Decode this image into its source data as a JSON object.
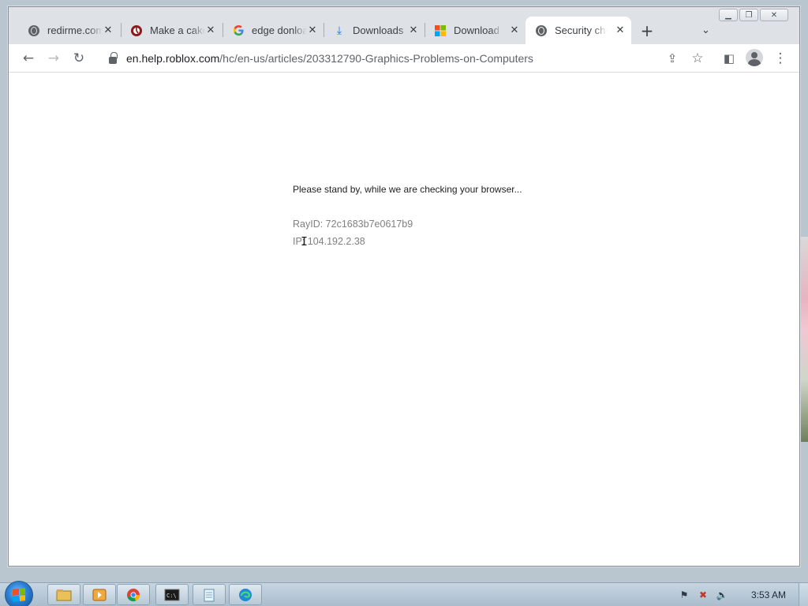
{
  "browser": {
    "tabs": [
      {
        "title": "redirme.com",
        "icon": "globe-icon"
      },
      {
        "title": "Make a cake",
        "icon": "cake-site-icon"
      },
      {
        "title": "edge donload",
        "icon": "google-icon"
      },
      {
        "title": "Downloads",
        "icon": "download-icon"
      },
      {
        "title": "Download Microsoft",
        "icon": "microsoft-icon"
      },
      {
        "title": "Security check",
        "icon": "globe-icon",
        "active": true
      }
    ],
    "url_domain": "en.help.roblox.com",
    "url_path": "/hc/en-us/articles/203312790-Graphics-Problems-on-Computers"
  },
  "page": {
    "standby_text": "Please stand by, while we are checking your browser...",
    "ray_id": "RayID: 72c1683b7e0617b9",
    "ip": "IP: 104.192.2.38"
  },
  "taskbar": {
    "clock": "3:53 AM",
    "pinned": [
      "file-explorer-icon",
      "media-player-icon",
      "chrome-icon",
      "command-prompt-icon",
      "notepad-icon",
      "edge-icon"
    ]
  },
  "colors": {
    "tabstrip": "#dee1e6",
    "ray_text": "#808080"
  }
}
